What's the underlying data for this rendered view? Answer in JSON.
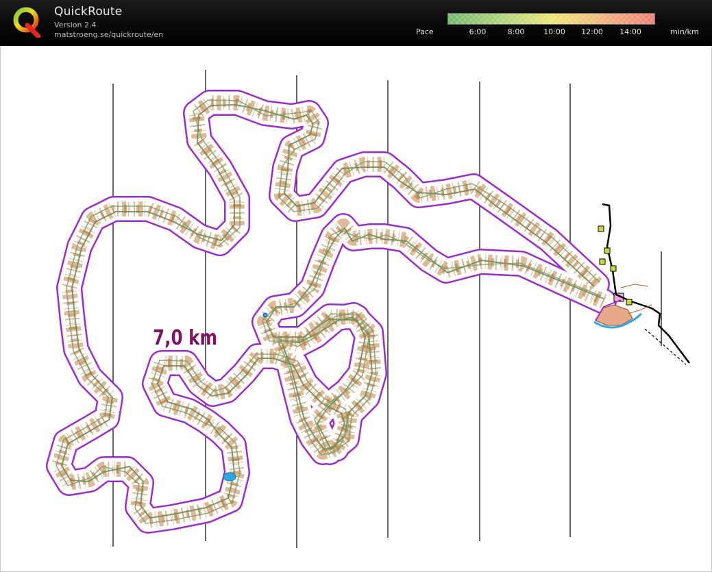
{
  "app": {
    "title": "QuickRoute",
    "version": "Version 2.4",
    "url": "matstroeng.se/quickroute/en"
  },
  "pace_legend": {
    "label": "Pace",
    "ticks": [
      "6:00",
      "8:00",
      "10:00",
      "12:00",
      "14:00"
    ],
    "unit": "min/km"
  },
  "map": {
    "distance_label": "7,0 km",
    "colors": {
      "course_outline": "#9b2bd0",
      "route_line": "#6c8f5a",
      "distance_text": "#7d1365",
      "contours": "#b5651d",
      "water": "#29a9e0",
      "road": "#000000"
    }
  }
}
